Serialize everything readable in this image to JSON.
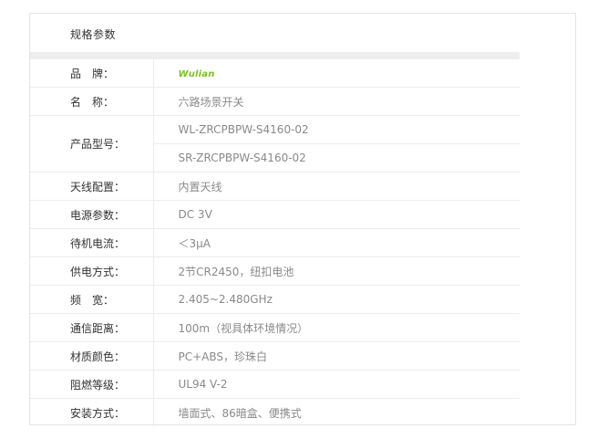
{
  "section_title": "规格参数",
  "specs": [
    {
      "label": "品　牌：",
      "value": "Wulian",
      "is_logo": true
    },
    {
      "label": "名　称：",
      "value": "六路场景开关"
    },
    {
      "label": "产品型号：",
      "values": [
        "WL-ZRCPBPW-S4160-02",
        "SR-ZRCPBPW-S4160-02"
      ]
    },
    {
      "label": "天线配置：",
      "value": "内置天线"
    },
    {
      "label": "电源参数：",
      "value": "DC 3V"
    },
    {
      "label": "待机电流：",
      "value": "＜3μA"
    },
    {
      "label": "供电方式：",
      "value": "2节CR2450，纽扣电池"
    },
    {
      "label": "频　宽：",
      "value": "2.405~2.480GHz"
    },
    {
      "label": "通信距离：",
      "value": "100m（视具体环境情况）"
    },
    {
      "label": "材质颜色：",
      "value": "PC+ABS，珍珠白"
    },
    {
      "label": "阻燃等级：",
      "value": "UL94 V-2"
    },
    {
      "label": "安装方式：",
      "value": "墙面式、86暗盒、便携式"
    }
  ],
  "colors": {
    "brand_green": "#7cc21e",
    "label_text": "#333333",
    "value_text": "#8a8a8a",
    "divider": "#ececec"
  }
}
